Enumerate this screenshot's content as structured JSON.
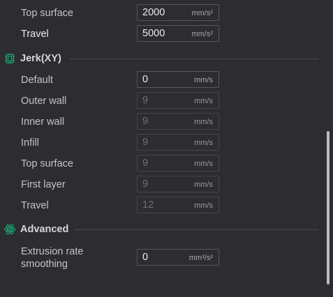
{
  "speed_rows": [
    {
      "label": "Top surface",
      "value": "2000",
      "unit": "mm/s²"
    },
    {
      "label": "Travel",
      "value": "5000",
      "unit": "mm/s²"
    }
  ],
  "jerk": {
    "title": "Jerk(XY)",
    "icon": "jerk-icon",
    "rows": [
      {
        "label": "Default",
        "value": "0",
        "unit": "mm/s"
      },
      {
        "label": "Outer wall",
        "value": "9",
        "unit": "mm/s"
      },
      {
        "label": "Inner wall",
        "value": "9",
        "unit": "mm/s"
      },
      {
        "label": "Infill",
        "value": "9",
        "unit": "mm/s"
      },
      {
        "label": "Top surface",
        "value": "9",
        "unit": "mm/s"
      },
      {
        "label": "First layer",
        "value": "9",
        "unit": "mm/s"
      },
      {
        "label": "Travel",
        "value": "12",
        "unit": "mm/s"
      }
    ]
  },
  "advanced": {
    "title": "Advanced",
    "icon": "atom-icon",
    "extrusion_label_line1": "Extrusion rate",
    "extrusion_label_line2": "smoothing",
    "extrusion_value": "0",
    "extrusion_unit": "mm³/s²"
  },
  "colors": {
    "background": "#2d2d31",
    "accent_icon": "#19a974"
  }
}
